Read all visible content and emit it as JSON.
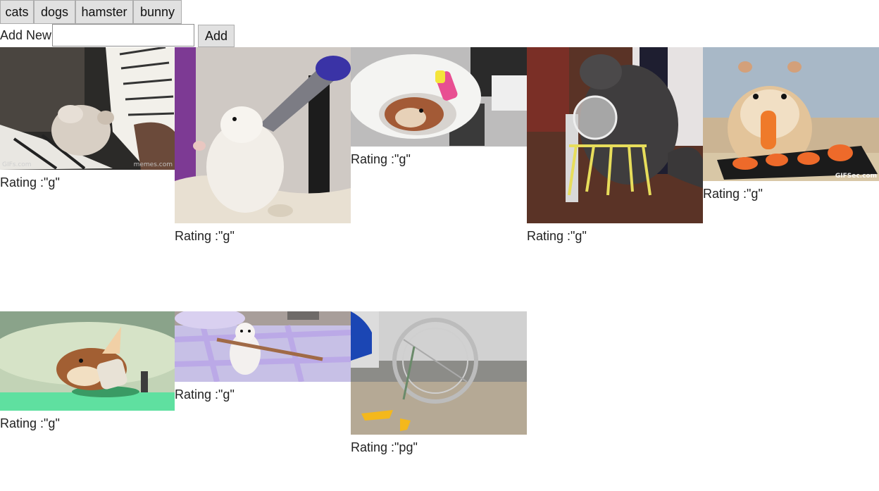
{
  "topics": [
    "cats",
    "dogs",
    "hamster",
    "bunny"
  ],
  "add_form": {
    "label": "Add New",
    "input_value": "",
    "button_label": "Add"
  },
  "rating_prefix": "Rating :",
  "gifs": [
    {
      "rating": "\"g\"",
      "subject": "hamster-on-piano",
      "watermark_left": "GIFs.com",
      "watermark": "memes.com"
    },
    {
      "rating": "\"g\"",
      "subject": "hamster-drinking-water-bottle"
    },
    {
      "rating": "\"g\"",
      "subject": "hamster-in-blanket-with-toy"
    },
    {
      "rating": "\"g\"",
      "subject": "cat-with-hamster-ball-walker"
    },
    {
      "rating": "\"g\"",
      "subject": "hamster-eating-carrot",
      "watermark": "GIFSec.com"
    },
    {
      "rating": "\"g\"",
      "subject": "hamster-with-party-hat"
    },
    {
      "rating": "\"g\"",
      "subject": "hamster-on-blanket-with-stick"
    },
    {
      "rating": "\"pg\"",
      "subject": "hamster-wheel-in-cage"
    }
  ]
}
